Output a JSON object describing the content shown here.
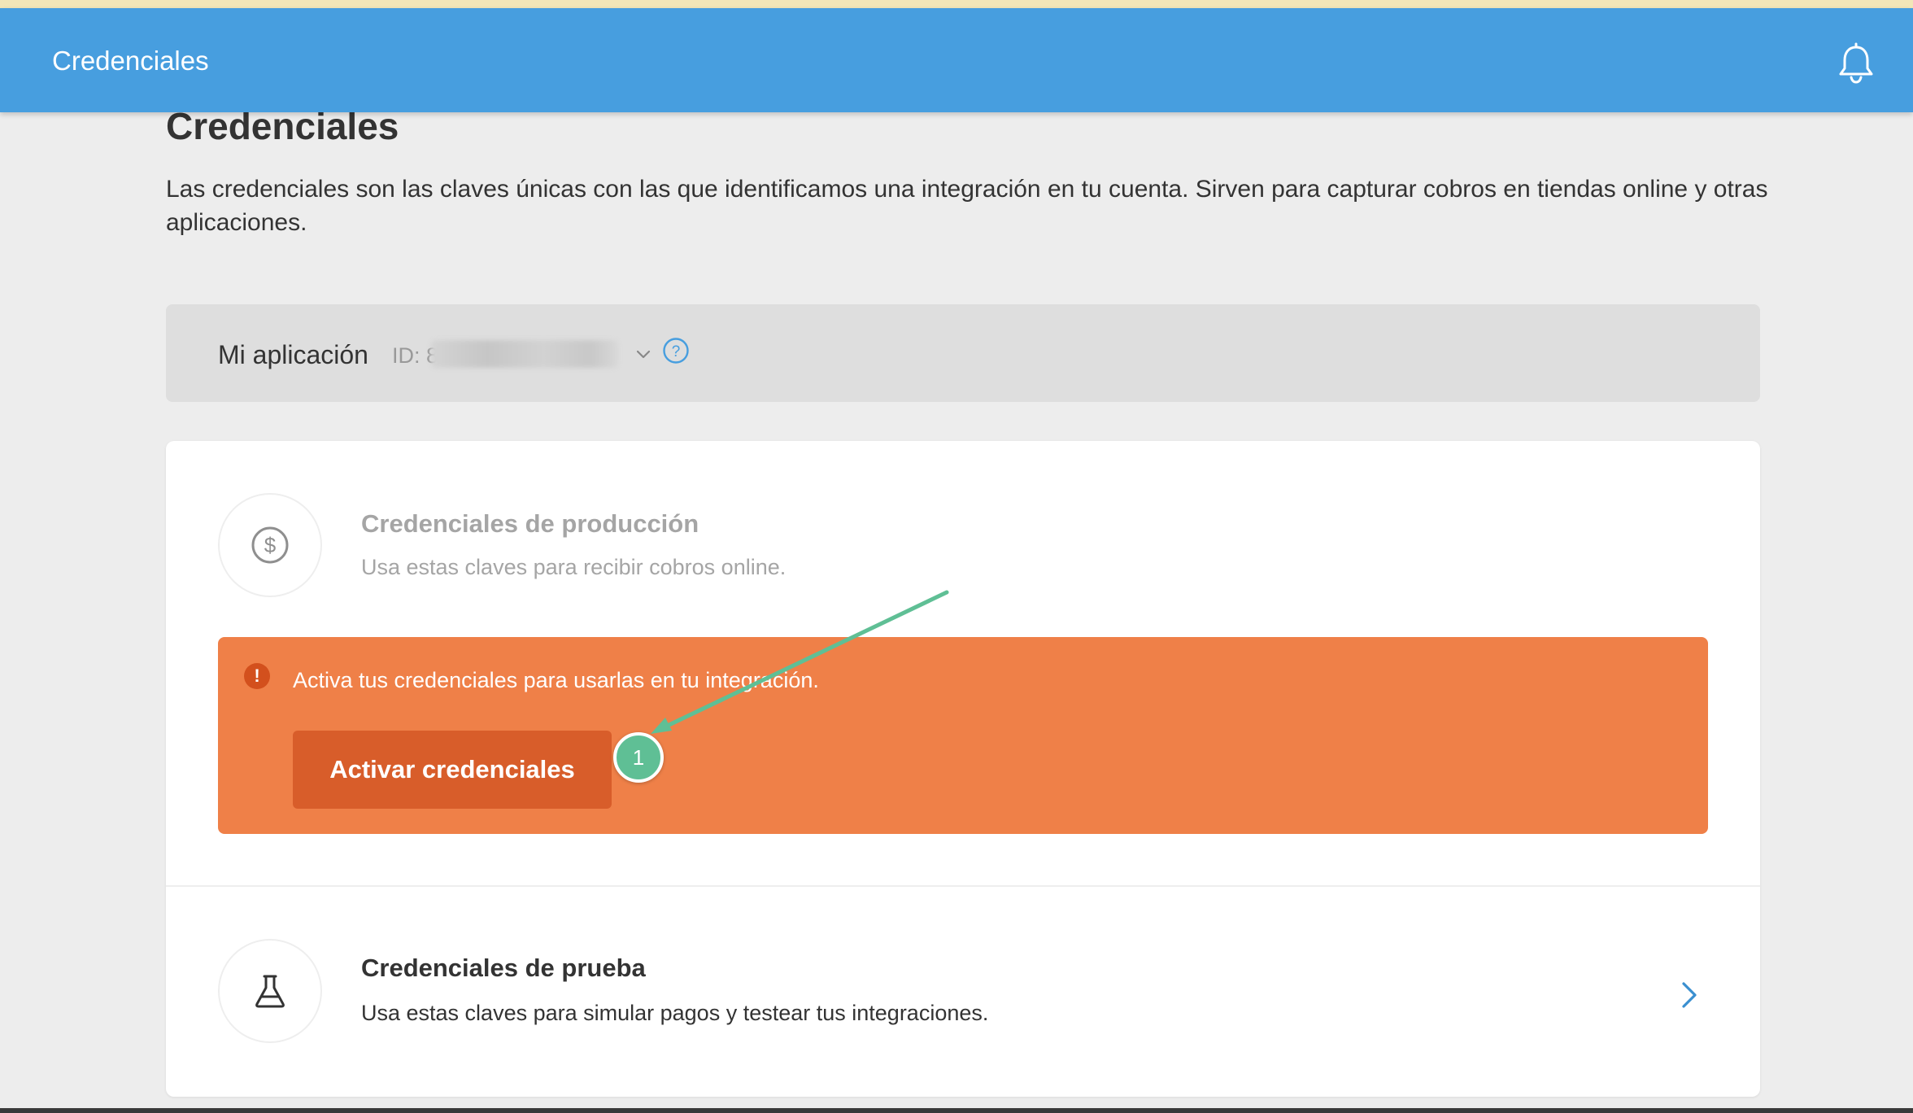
{
  "header": {
    "title": "Credenciales",
    "bell_icon": "bell-icon",
    "color": "#479edf"
  },
  "page": {
    "title": "Credenciales",
    "description": "Las credenciales son las claves únicas con las que identificamos una integración en tu cuenta. Sirven para capturar cobros en tiendas online y otras aplicaciones."
  },
  "app_selector": {
    "label": "Mi aplicación",
    "id_prefix": "ID: 8",
    "chevron_icon": "chevron-down-icon",
    "help_icon": "help-icon"
  },
  "production": {
    "icon": "dollar-icon",
    "title": "Credenciales de producción",
    "description": "Usa estas claves para recibir cobros online.",
    "alert": {
      "icon": "alert-icon",
      "glyph": "!",
      "text": "Activa tus credenciales para usarlas en tu integración.",
      "button_label": "Activar credenciales",
      "color": "#ef8048",
      "button_color": "#d85d2a"
    }
  },
  "test": {
    "icon": "flask-icon",
    "title": "Credenciales de prueba",
    "description": "Usa estas claves para simular pagos y testear tus integraciones.",
    "chevron_icon": "chevron-right-icon"
  },
  "annotation": {
    "step": "1",
    "color": "#5fbf95"
  }
}
